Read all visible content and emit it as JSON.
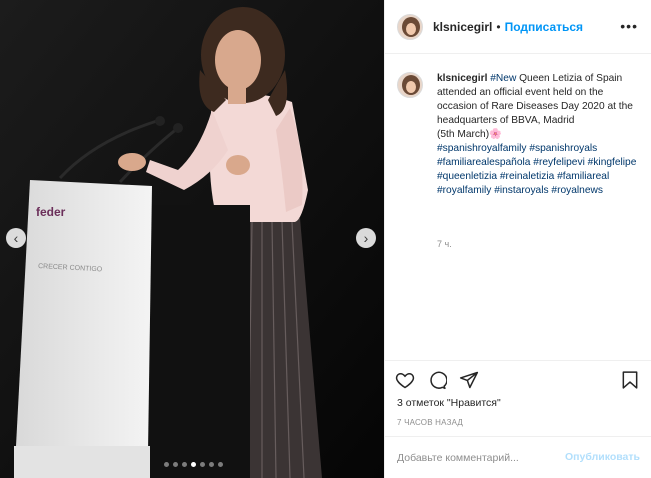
{
  "post": {
    "username": "klsnicegirl",
    "follow_label": "Подписаться",
    "more_label": "•••",
    "image_alt": "",
    "podium_logo": "feder",
    "podium_subtext": "CRECER CONTIGO",
    "carousel": {
      "count": 7,
      "active_index": 3
    }
  },
  "caption": {
    "username": "klsnicegirl",
    "lead_tag": "#New",
    "text": " Queen Letizia of Spain attended an official event held on the occasion of Rare Diseases Day 2020 at the headquarters of BBVA, Madrid",
    "date": "(5th March)",
    "emoji": "🌸",
    "hashtags": [
      "#spanishroyalfamily",
      "#spanishroyals",
      "#familiarealespañola",
      "#reyfelipevi",
      "#kingfelipe",
      "#queenletizia",
      "#reinaletizia",
      "#familiareal",
      "#royalfamily",
      "#instaroyals",
      "#royalnews"
    ],
    "time": "7 ч."
  },
  "actions": {
    "icons": [
      "heart-icon",
      "comment-bubble-icon",
      "share-icon",
      "bookmark-icon"
    ],
    "likes_text": "3 отметок \"Нравится\"",
    "posted_ago": "7 ЧАСОВ НАЗАД"
  },
  "comment_input": {
    "placeholder": "Добавьте комментарий...",
    "value": "",
    "publish_label": "Опубликовать"
  },
  "colors": {
    "link": "#0095f6",
    "hashtag": "#00376b",
    "muted": "#8e8e8e",
    "publish_disabled": "#b2dffc"
  }
}
